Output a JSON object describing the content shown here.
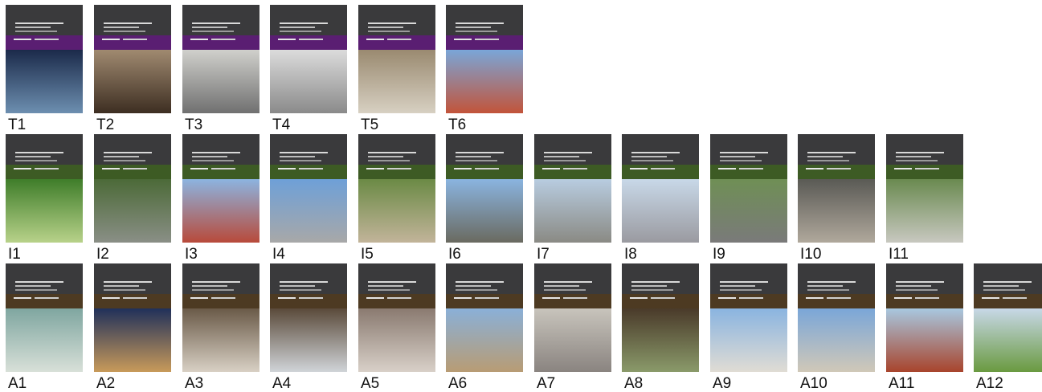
{
  "rows": [
    {
      "band_color": "#5a1e72",
      "items": [
        {
          "label": "T1",
          "photo": [
            "#1b2a4a",
            "#6d8fb0"
          ]
        },
        {
          "label": "T2",
          "photo": [
            "#a08a70",
            "#3d2e22"
          ]
        },
        {
          "label": "T3",
          "photo": [
            "#d0d0cc",
            "#707070"
          ]
        },
        {
          "label": "T4",
          "photo": [
            "#dcdcdc",
            "#8a8a8a"
          ]
        },
        {
          "label": "T5",
          "photo": [
            "#9a8a70",
            "#d7d0c2"
          ]
        },
        {
          "label": "T6",
          "photo": [
            "#7aa6d8",
            "#c2543a"
          ]
        }
      ]
    },
    {
      "band_color": "#3d5b24",
      "items": [
        {
          "label": "I1",
          "photo": [
            "#3f7d2a",
            "#b8d28a"
          ]
        },
        {
          "label": "I2",
          "photo": [
            "#4c6a38",
            "#8a8f86"
          ]
        },
        {
          "label": "I3",
          "photo": [
            "#8cb4e0",
            "#b84a3a"
          ]
        },
        {
          "label": "I4",
          "photo": [
            "#6ea0d8",
            "#a8a8a8"
          ]
        },
        {
          "label": "I5",
          "photo": [
            "#6b8a45",
            "#c2b49a"
          ]
        },
        {
          "label": "I6",
          "photo": [
            "#8ab4e0",
            "#6a6a60"
          ]
        },
        {
          "label": "I7",
          "photo": [
            "#b8cce0",
            "#8a8a84"
          ]
        },
        {
          "label": "I8",
          "photo": [
            "#c8d8e8",
            "#9a9aa0"
          ]
        },
        {
          "label": "I9",
          "photo": [
            "#6f8f55",
            "#7a7a7a"
          ]
        },
        {
          "label": "I10",
          "photo": [
            "#5a5a55",
            "#b0a89c"
          ]
        },
        {
          "label": "I11",
          "photo": [
            "#6a8a50",
            "#c8c8c0"
          ]
        }
      ]
    },
    {
      "band_color": "#4d3a22",
      "items": [
        {
          "label": "A1",
          "photo": [
            "#7fa6a0",
            "#d8e0d8"
          ]
        },
        {
          "label": "A2",
          "photo": [
            "#20305a",
            "#c89a5a"
          ]
        },
        {
          "label": "A3",
          "photo": [
            "#6a5a48",
            "#d8d0c4"
          ]
        },
        {
          "label": "A4",
          "photo": [
            "#5a4a3a",
            "#d0d4d8"
          ]
        },
        {
          "label": "A5",
          "photo": [
            "#8a7a70",
            "#d8d0c8"
          ]
        },
        {
          "label": "A6",
          "photo": [
            "#8ab0d8",
            "#b89c74"
          ]
        },
        {
          "label": "A7",
          "photo": [
            "#c8c4bc",
            "#8a8480"
          ]
        },
        {
          "label": "A8",
          "photo": [
            "#4a3a2a",
            "#8a9a6a"
          ]
        },
        {
          "label": "A9",
          "photo": [
            "#8ab4e0",
            "#e0dcd4"
          ]
        },
        {
          "label": "A10",
          "photo": [
            "#7aa6d8",
            "#d0c8b8"
          ]
        },
        {
          "label": "A11",
          "photo": [
            "#a8c8e0",
            "#a8442c"
          ]
        },
        {
          "label": "A12",
          "photo": [
            "#c8d8e8",
            "#6a9a40"
          ]
        }
      ]
    }
  ]
}
